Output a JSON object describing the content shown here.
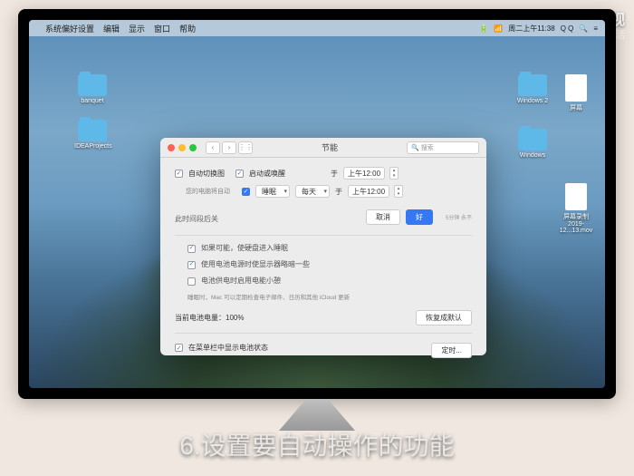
{
  "watermark": {
    "main": "天奇·视",
    "sub": "天奇生活"
  },
  "menubar": {
    "items": [
      "系统偏好设置",
      "编辑",
      "显示",
      "窗口",
      "帮助"
    ],
    "right": {
      "time": "周二上午11:38",
      "user": "Q Q"
    }
  },
  "desktop": {
    "icons": [
      {
        "label": "banquet",
        "type": "folder"
      },
      {
        "label": "IDEAProjects",
        "type": "folder"
      },
      {
        "label": "Windows 2",
        "type": "folder"
      },
      {
        "label": "屏幕",
        "type": "file"
      },
      {
        "label": "Windows",
        "type": "folder"
      },
      {
        "label": "屏幕录制\n2019-12...13.mov",
        "type": "file"
      }
    ]
  },
  "window": {
    "title": "节能",
    "search_placeholder": "搜索",
    "schedule": {
      "auto_switch": "自动切换图",
      "auto_switch_note": "您的电脑将自动",
      "startup_wake": "启动或唤醒",
      "sleep_label": "睡眠",
      "freq": "每天",
      "at": "于",
      "time1": "上午12:00",
      "time2": "上午12:00",
      "delay_label": "此时间段后关",
      "cancel": "取消",
      "ok": "好"
    },
    "options": {
      "o1": "如果可能，使硬盘进入睡眠",
      "o2": "使用电池电源时使显示器略暗一些",
      "o3": "电池供电时启用电能小憩",
      "note": "睡眠时，Mac 可以定期检查电子邮件、日历和其他 iCloud 更新"
    },
    "battery": {
      "label": "当前电池电量：100%",
      "restore": "恢复成默认"
    },
    "footer": {
      "show_status": "在菜单栏中显示电池状态",
      "schedule_btn": "定时..."
    }
  },
  "slider_ticks": "5分钟    永不",
  "subtitle": "6.设置要自动操作的功能"
}
